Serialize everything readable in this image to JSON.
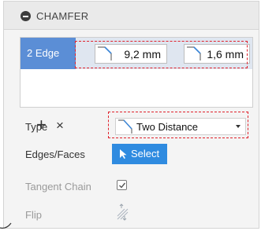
{
  "header": {
    "title": "CHAMFER",
    "collapse_icon": "collapse-minus-icon"
  },
  "selection": {
    "label": "2 Edge",
    "distance_1": "9,2 mm",
    "distance_2": "1,6 mm",
    "add_icon": "+",
    "remove_icon": "×"
  },
  "type": {
    "label": "Type",
    "value": "Two Distance",
    "icon": "chamfer-two-distance-icon"
  },
  "edges_faces": {
    "label": "Edges/Faces",
    "button_label": "Select",
    "icon": "cursor-arrow-icon"
  },
  "tangent_chain": {
    "label": "Tangent Chain",
    "checked": true
  },
  "flip": {
    "label": "Flip",
    "icon": "flip-icon"
  },
  "colors": {
    "accent": "#2f8be0",
    "selection_label": "#5b8ed6",
    "highlight_dashed": "#e0202a"
  }
}
